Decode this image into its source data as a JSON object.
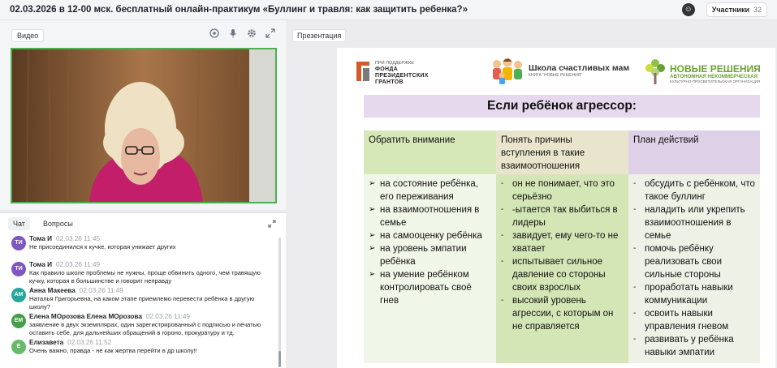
{
  "header": {
    "title": "02.03.2026 в 12-00 мск. бесплатный онлайн-практикум «Буллинг и травля: как защитить ребенка?»",
    "participants_label": "Участники",
    "participants_count": "32"
  },
  "video": {
    "tab_label": "Видео"
  },
  "chat": {
    "tabs": [
      {
        "label": "Чат"
      },
      {
        "label": "Вопросы"
      }
    ],
    "messages": [
      {
        "initials": "ТИ",
        "color": "#7e57c2",
        "author": "Тома И",
        "time": "02.03.26 11:45",
        "text": "Не присоединился к кучке, которая унижает других"
      },
      {
        "initials": "ТИ",
        "color": "#7e57c2",
        "author": "Тома И",
        "time": "02.03.26 11:49",
        "text": "Как правило школе проблемы не нужны, проще обвинить одного, чем травящую кучку, которая в большинстве и говорит неправду"
      },
      {
        "initials": "АМ",
        "color": "#26a69a",
        "author": "Анна Макеева",
        "time": "02.03.26 11:49",
        "text": "Наталья Григорьевна, на каком этапе приемлемо перевести ребёнка в другую школу?"
      },
      {
        "initials": "ЕМ",
        "color": "#43a047",
        "author": "Елена МОрозова Елена МОрозова",
        "time": "02.03.26 11:49",
        "text": "заявление в двух экземплярах, один зарегистрированный с подписью и печатью оставить себе, для дальнейших обращений в гороно, прокуратуру и тд."
      },
      {
        "initials": "Е",
        "color": "#66bb6a",
        "author": "Елизавета",
        "time": "02.03.26 11:52",
        "text": "Очень важно, правда - не как жертва перейти в др школу!!"
      }
    ]
  },
  "presentation": {
    "tab_label": "Презентация",
    "logos": {
      "fund": {
        "small": "ПРИ ПОДДЕРЖКЕ",
        "line1": "ФОНДА",
        "line2": "ПРЕЗИДЕНТСКИХ",
        "line3": "ГРАНТОВ"
      },
      "school": {
        "name": "Школа счастливых мам",
        "sub": "КНИГА \"НОВЫЕ РЕШЕНИЯ\""
      },
      "org": {
        "name": "НОВЫЕ РЕШЕНИЯ",
        "sub": "АВТОНОМНАЯ НЕКОММЕРЧЕСКАЯ",
        "sub2": "КУЛЬТУРНО-ПРОСВЕТИТЕЛЬСКАЯ ОРГАНИЗАЦИЯ"
      }
    },
    "slide_title": "Если ребёнок агрессор:",
    "columns": [
      {
        "header": "Обратить внимание",
        "marker": "➢",
        "items": [
          "на состояние ребёнка, его переживания",
          "на взаимоотношения в семье",
          "на самооценку ребёнка",
          "на уровень эмпатии ребёнка",
          "на умение ребёнком контролировать своё гнев"
        ]
      },
      {
        "header": "Понять причины вступления в такие взаимоотношения",
        "marker": "-",
        "items": [
          "он не понимает, что это серьёзно",
          "-ытается так выбиться в лидеры",
          "завидует, ему чего-то не хватает",
          "испытывает сильное давление со стороны своих взрослых",
          "высокий уровень агрессии, с которым он не справляется"
        ]
      },
      {
        "header": "План действий",
        "marker": "-",
        "items": [
          "обсудить с ребёнком, что такое буллинг",
          "наладить или укрепить взаимоотношения в семье",
          "помочь ребёнку реализовать свои сильные стороны",
          "проработать навыки коммуникации",
          "освоить навыки управления гневом",
          "развивать у ребёнка навыки эмпатии"
        ]
      }
    ]
  }
}
